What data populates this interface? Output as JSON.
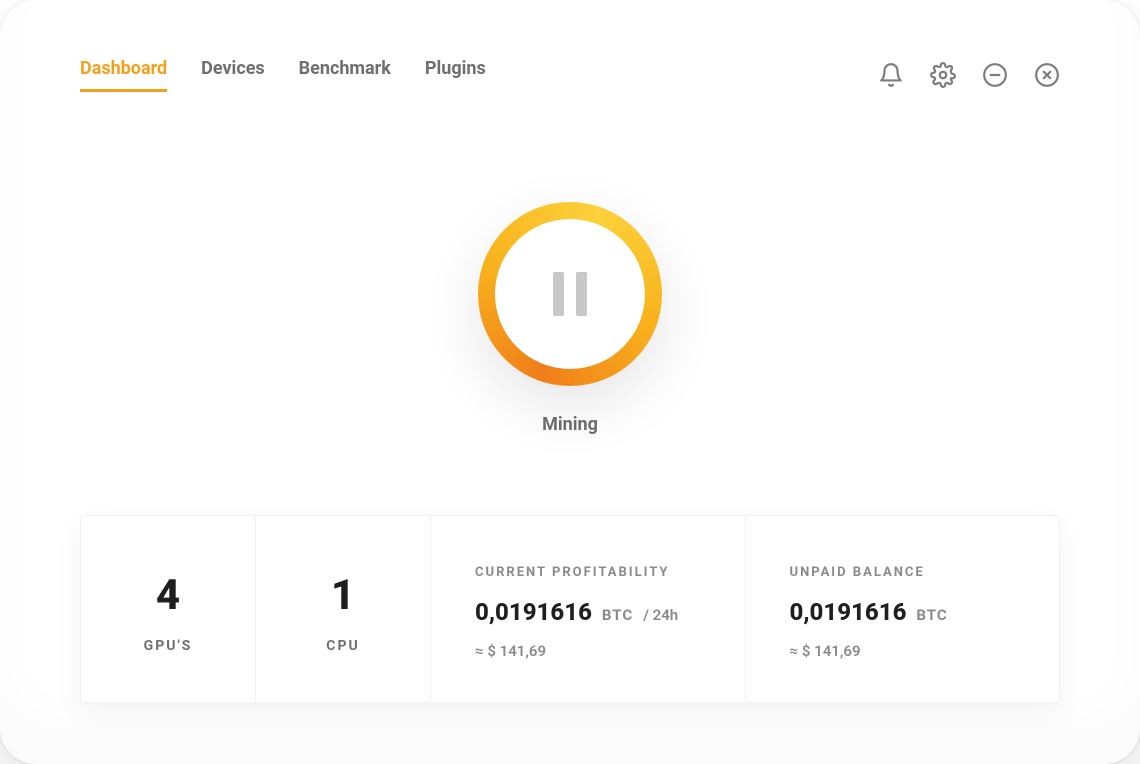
{
  "nav": {
    "tabs": [
      {
        "label": "Dashboard",
        "active": true
      },
      {
        "label": "Devices",
        "active": false
      },
      {
        "label": "Benchmark",
        "active": false
      },
      {
        "label": "Plugins",
        "active": false
      }
    ],
    "icons": [
      "bell-icon",
      "gear-icon",
      "minimize-icon",
      "close-icon"
    ]
  },
  "mining": {
    "state_label": "Mining",
    "button_state": "pause"
  },
  "stats": {
    "gpu": {
      "value": "4",
      "label": "GPU'S"
    },
    "cpu": {
      "value": "1",
      "label": "CPU"
    },
    "profitability": {
      "title": "CURRENT PROFITABILITY",
      "amount": "0,0191616",
      "unit": "BTC",
      "per": "/ 24h",
      "approx": "≈ $ 141,69"
    },
    "balance": {
      "title": "UNPAID BALANCE",
      "amount": "0,0191616",
      "unit": "BTC",
      "approx": "≈ $ 141,69"
    }
  },
  "colors": {
    "accent": "#f5a01b"
  }
}
